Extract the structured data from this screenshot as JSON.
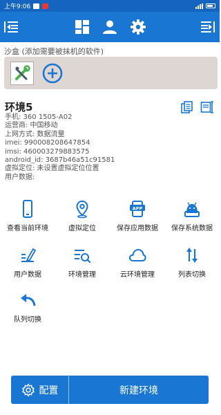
{
  "status_bar": {
    "time": "上午9:06"
  },
  "appbar": {
    "icons": [
      "menu-collapse-icon",
      "dashboard-icon",
      "user-icon",
      "settings-icon",
      "menu-expand-icon"
    ]
  },
  "sandbox": {
    "label": "沙盒 (添加需要被抹机的软件)"
  },
  "environment": {
    "title": "环境5",
    "info": [
      "手机: 360 1505-A02",
      "运营商: 中国移动",
      "上网方式: 数据流量",
      "imei: 990008208647854",
      "imsi: 460003279883575",
      "android_id: 3687b46a51c91581",
      "虚拟定位: 未设置虚拟定位位置",
      "用户数据:"
    ]
  },
  "functions": {
    "view_env": "查看当前环境",
    "virtual_location": "虚拟定位",
    "save_app_data": "保存应用数据",
    "save_system_data": "保存系统数据",
    "user_data": "用户数据",
    "env_manage": "环境管理",
    "cloud_env_manage": "云环境管理",
    "list_switch": "列表切换",
    "queue_switch": "队列切换"
  },
  "bottom": {
    "config_label": "配置",
    "new_env_label": "新建环境"
  },
  "colors": {
    "primary": "#1976d2",
    "status_bar": "#1565c0",
    "sandbox_bg": "#ddd6d3"
  }
}
